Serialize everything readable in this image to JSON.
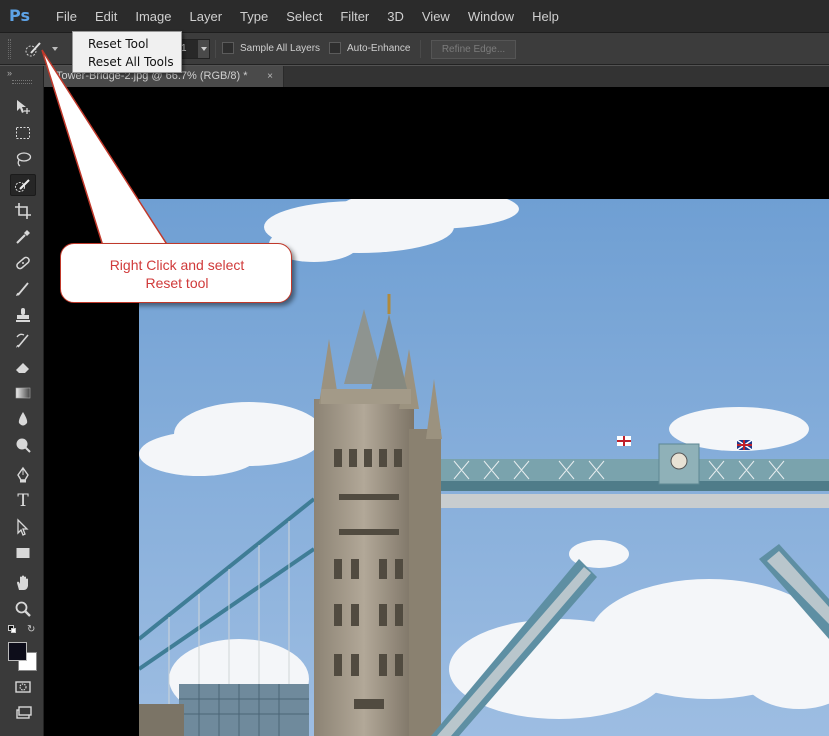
{
  "app": {
    "logo": "Ps",
    "menu": [
      "File",
      "Edit",
      "Image",
      "Layer",
      "Type",
      "Select",
      "Filter",
      "3D",
      "View",
      "Window",
      "Help"
    ]
  },
  "options_bar": {
    "tool_icon": "quick-selection-brush-icon",
    "brush_size_value": "1",
    "sample_all_layers": "Sample All Layers",
    "auto_enhance": "Auto-Enhance",
    "refine_edge": "Refine Edge..."
  },
  "context_menu": {
    "items": [
      "Reset Tool",
      "Reset All Tools"
    ]
  },
  "document": {
    "tab_title": "Tower-Bridge-2.jpg @ 66.7% (RGB/8) *",
    "close_glyph": "×"
  },
  "toolbox": {
    "collapse_glyph": "»",
    "tools": [
      "move-tool-icon",
      "marquee-tool-icon",
      "lasso-tool-icon",
      "quick-selection-tool-icon",
      "crop-tool-icon",
      "eyedropper-tool-icon",
      "healing-brush-tool-icon",
      "brush-tool-icon",
      "clone-stamp-tool-icon",
      "history-brush-tool-icon",
      "eraser-tool-icon",
      "gradient-tool-icon",
      "blur-tool-icon",
      "dodge-tool-icon",
      "pen-tool-icon",
      "type-tool-icon",
      "path-selection-tool-icon",
      "rectangle-tool-icon",
      "hand-tool-icon",
      "zoom-tool-icon"
    ],
    "type_tool_glyph": "T",
    "foreground_color": "#0d0d1a",
    "background_color": "#ffffff"
  },
  "callout": {
    "line1": "Right Click and select",
    "line2": "Reset tool"
  },
  "colors": {
    "accent_logo": "#5ea3e6",
    "callout_text": "#d03a3a",
    "sky": "#7fa9d6"
  }
}
